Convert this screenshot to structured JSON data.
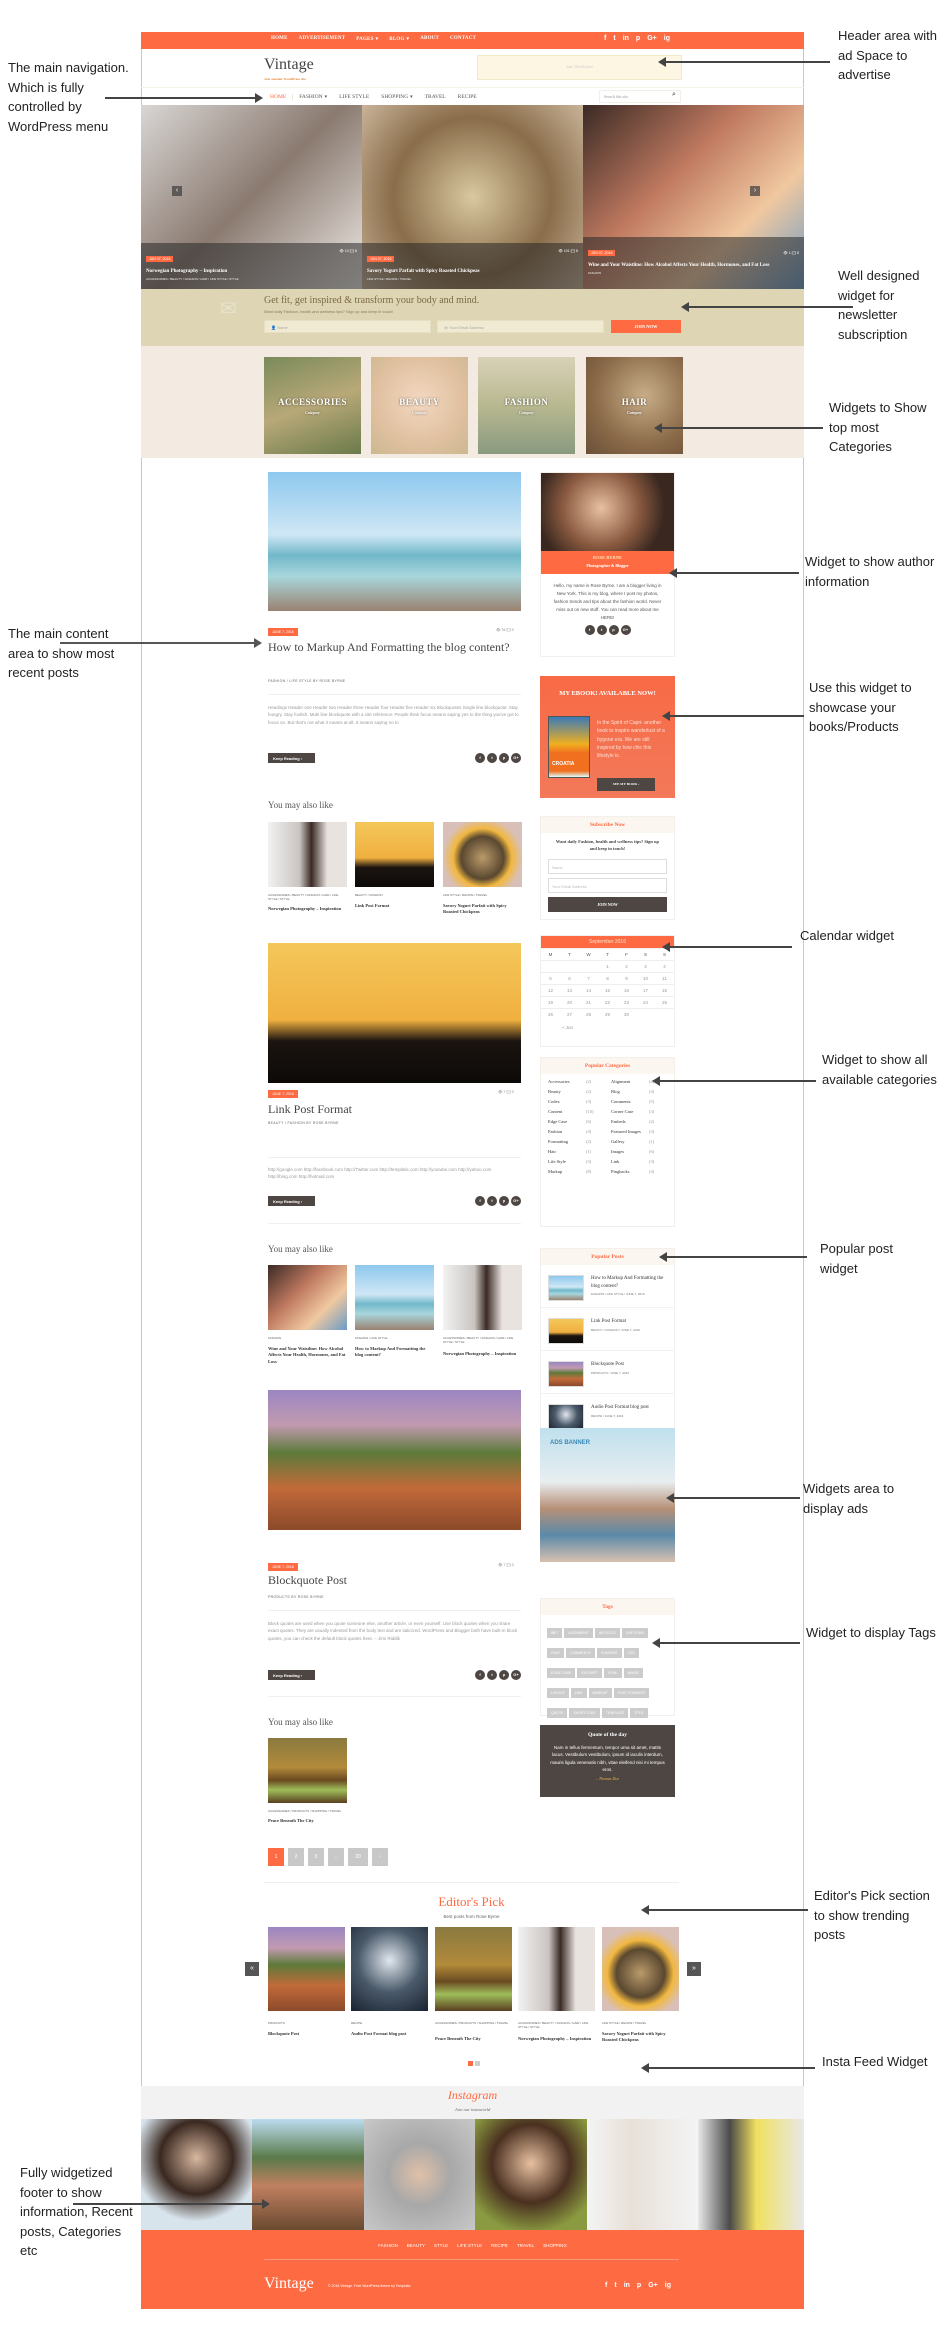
{
  "colors": {
    "accent": "#fe6a41",
    "dark": "#4d4643",
    "newsletter_bg": "#ded5b4",
    "category_band": "#f3ebe2"
  },
  "topbar": {
    "menu": [
      "HOME",
      "ADVERTISEMENT",
      "PAGES",
      "BLOG",
      "ABOUT",
      "CONTACT"
    ],
    "social": [
      "f",
      "t",
      "in",
      "p",
      "G+",
      "ig"
    ]
  },
  "header": {
    "logo": "Vintage",
    "tagline": "Just another WordPress site",
    "ad": "Ads 728x90 pixel"
  },
  "nav": {
    "items": [
      "HOME",
      "FASHION",
      "LIFE STYLE",
      "SHOPPING",
      "TRAVEL",
      "RECIPE"
    ],
    "search_placeholder": "Search this site"
  },
  "hero": [
    {
      "date": "JUN 07, 2016",
      "title": "Norwegian Photography – Inspiration",
      "cats": "ACCESSORIES / BEAUTY / FASHION / HAIR / LIFE STYLE / STYLE",
      "views": "10",
      "comments": "8"
    },
    {
      "date": "JUN 07, 2016",
      "title": "Savory Yogurt Parfait with Spicy Roasted Chickpeas",
      "cats": "LIFE STYLE / RECIPE / TRAVEL",
      "views": "101",
      "comments": "8"
    },
    {
      "date": "JUN 07, 2016",
      "title": "Wine and Your Waistline: How Alcohol Affects Your Health, Hormones, and Fat Loss",
      "cats": "FASHION",
      "views": "1",
      "comments": "8"
    }
  ],
  "newsletter": {
    "title": "Get fit, get inspired & transform your body and mind.",
    "subtitle": "Want daily Fashion, health and wellness tips? Sign up and keep in touch!",
    "name_placeholder": "Name",
    "email_placeholder": "Your Email Address",
    "button": "JOIN NOW"
  },
  "categories": [
    {
      "name": "ACCESSORIES",
      "sub": "Category"
    },
    {
      "name": "BEAUTY",
      "sub": "Category"
    },
    {
      "name": "FASHION",
      "sub": "Category"
    },
    {
      "name": "HAIR",
      "sub": "Category"
    }
  ],
  "posts": [
    {
      "date": "JUNE 7, 2016",
      "title": "How to Markup And Formatting the blog content?",
      "meta": "FASHION  /  LIFE STYLE BY ROSE BYRNE",
      "views": "76",
      "comments": "0",
      "excerpt": "Headings Header one Header two Header three Header four Header five Header six Blockquotes Single line blockquote: Stay hungry. Stay foolish. Multi line blockquote with a cite reference: People think focus means saying yes to the thing you've got to focus on. But that's not what it means at all. It means saying no to",
      "keep": "Keep Reading ›",
      "related": [
        {
          "cats": "ACCESSORIES / BEAUTY / FASHION / HAIR / LIFE STYLE / STYLE",
          "title": "Norwegian Photography – Inspiration"
        },
        {
          "cats": "BEAUTY / FASHION",
          "title": "Link Post Format"
        },
        {
          "cats": "LIFE STYLE / RECIPE / TRAVEL",
          "title": "Savory Yogurt Parfait with Spicy Roasted Chickpeas"
        }
      ]
    },
    {
      "date": "JUNE 7, 2016",
      "title": "Link Post Format",
      "meta": "BEAUTY  /  FASHION BY ROSE BYRNE",
      "views": "7",
      "comments": "0",
      "excerpt": "http://google.com http://facebook.com http://Twitter.com http://templatic.com http://youtube.com http://yahoo.com http://bing.com http://hotmail.com",
      "keep": "Keep Reading ›",
      "related": [
        {
          "cats": "FASHION",
          "title": "Wine and Your Waistline: How Alcohol Affects Your Health, Hormones, and Fat Loss"
        },
        {
          "cats": "FASHION / LIFE STYLE",
          "title": "How to Markup And Formatting the blog content?"
        },
        {
          "cats": "ACCESSORIES / BEAUTY / FASHION / HAIR / LIFE STYLE / STYLE",
          "title": "Norwegian Photography – Inspiration"
        }
      ]
    },
    {
      "date": "JUNE 7, 2016",
      "title": "Blockquote Post",
      "meta": "PRODUCTS BY ROSE BYRNE",
      "views": "7",
      "comments": "0",
      "excerpt": "Block quotes are used when you quote someone else, another article, or even yourself. Use block quotes when you share exact quotes. They are usually indented from the body text and are italicized. WordPress and Blogger both have built-in block quotes, you can check the default block quotes here. – Jimi Riddik",
      "keep": "Keep Reading ›",
      "related": [
        {
          "cats": "ACCESSORIES / PRODUCTS / SHOPPING / TRAVEL",
          "title": "Peace Beneath The City"
        }
      ]
    }
  ],
  "you_may_also_like": "You may also like",
  "pagination": [
    "1",
    "2",
    "3",
    "...",
    "20",
    "›"
  ],
  "sidebar": {
    "author": {
      "name": "ROSE BYRNE",
      "role": "Photographer & Blogger",
      "bio": "Hello, my name is Rose Byrne. I am a blogger living in New York. This is my blog, where I post my photos, fashion trends and tips about the fashion world. Never miss out on new stuff. You can read more about me HERE!"
    },
    "ebook": {
      "title": "MY EBOOK! AVAILABLE NOW!",
      "text": "In the Spirit of Capri- another book to inspire wanderlust of a bygone era. We are still inspired by how chic this lifestyle is.",
      "button": "SEE MY BOOK ›",
      "cover_text": "CROATIA"
    },
    "subscribe": {
      "title": "Subscribe Now",
      "text": "Want daily Fashion, health and wellness tips? Sign up and keep in touch!",
      "name_placeholder": "Name",
      "email_placeholder": "Your Email Address",
      "button": "JOIN NOW"
    },
    "calendar": {
      "month": "September 2016",
      "days": [
        "M",
        "T",
        "W",
        "T",
        "F",
        "S",
        "S"
      ],
      "rows": [
        [
          "",
          "",
          "",
          "1",
          "2",
          "3",
          "4"
        ],
        [
          "5",
          "6",
          "7",
          "8",
          "9",
          "10",
          "11"
        ],
        [
          "12",
          "13",
          "14",
          "15",
          "16",
          "17",
          "18"
        ],
        [
          "19",
          "20",
          "21",
          "22",
          "23",
          "24",
          "25"
        ],
        [
          "26",
          "27",
          "28",
          "29",
          "30",
          "",
          ""
        ]
      ],
      "prev": "« Jun"
    },
    "popular_categories": {
      "title": "Popular Categories",
      "items": [
        [
          "Accessories",
          "(2)"
        ],
        [
          "Alignment",
          "(4)"
        ],
        [
          "Beauty",
          "(2)"
        ],
        [
          "Blog",
          "(4)"
        ],
        [
          "Codex",
          "(3)"
        ],
        [
          "Comments",
          "(5)"
        ],
        [
          "Content",
          "(10)"
        ],
        [
          "Corner Case",
          "(3)"
        ],
        [
          "Edge Case",
          "(6)"
        ],
        [
          "Embeds",
          "(2)"
        ],
        [
          "Fashion",
          "(4)"
        ],
        [
          "Featured Images",
          "(3)"
        ],
        [
          "Formatting",
          "(2)"
        ],
        [
          "Gallery",
          "(1)"
        ],
        [
          "Hair",
          "(1)"
        ],
        [
          "Images",
          "(6)"
        ],
        [
          "Life Style",
          "(3)"
        ],
        [
          "Link",
          "(3)"
        ],
        [
          "Markup",
          "(8)"
        ],
        [
          "Pingbacks",
          "(4)"
        ]
      ]
    },
    "popular_posts": {
      "title": "Popular Posts",
      "items": [
        {
          "title": "How to Markup And Formatting the blog content?",
          "meta": "FASHION / LIFE STYLE / JUNE 7, 2016"
        },
        {
          "title": "Link Post Format",
          "meta": "BEAUTY / FASHION / JUNE 7, 2016"
        },
        {
          "title": "Blockquote Post",
          "meta": "PRODUCTS / JUNE 7, 2016"
        },
        {
          "title": "Audio Post Format blog post",
          "meta": "RECIPE / JUNE 7, 2016"
        }
      ]
    },
    "ad_banner": {
      "label": "ADS BANNER"
    },
    "tags": {
      "title": "Tags",
      "items": [
        "8BIT",
        "ALIGNMENT",
        "ARTICLES",
        "CAPTIONS",
        "CHAT",
        "COMMENTS",
        "CONTENT",
        "CSS",
        "EDGE CASE",
        "EXCERPT",
        "HTML",
        "IMAGE",
        "LAYOUT",
        "LINK",
        "MARKUP",
        "POST FORMATS",
        "QUOTE",
        "SHORTCODE",
        "TEMPLATE",
        "TITLE"
      ]
    },
    "quote": {
      "title": "Quote of the day",
      "text": "Nam in tellus fermentum, tempor urna sit amet, mattis lacus. Vestibulum vestibulum, ipsum id iaculis interdum, mauris ligula venenatis nibh, vitae eleifend nisi mi tempus eros.",
      "author": "– Thomas Doe"
    }
  },
  "editors_pick": {
    "title": "Editor's Pick",
    "subtitle": "Best posts from Rose Byrne",
    "items": [
      {
        "cats": "PRODUCTS",
        "title": "Blockquote Post"
      },
      {
        "cats": "RECIPE",
        "title": "Audio Post Format blog post"
      },
      {
        "cats": "ACCESSORIES / PRODUCTS / SHOPPING / TRAVEL",
        "title": "Peace Beneath The City"
      },
      {
        "cats": "ACCESSORIES / BEAUTY / FASHION / HAIR / LIFE STYLE / STYLE",
        "title": "Norwegian Photography – Inspiration"
      },
      {
        "cats": "LIFE STYLE / RECIPE / TRAVEL",
        "title": "Savory Yogurt Parfait with Spicy Roasted Chickpeas"
      }
    ],
    "active_page": 1,
    "pages": 2
  },
  "instagram": {
    "title": "Instagram",
    "subtitle": "Join our instaworld"
  },
  "footer": {
    "menu": [
      "FASHION",
      "BEAUTY",
      "STYLE",
      "LIFE STYLE",
      "RECIPE",
      "TRAVEL",
      "SHOPPING"
    ],
    "logo": "Vintage",
    "copyright": "© 2016 Vintage. Free WordPress theme by Templatic",
    "social": [
      "f",
      "t",
      "in",
      "p",
      "G+",
      "ig"
    ]
  },
  "annotations": {
    "nav": "The main navigation. Which is fully controlled by WordPress menu",
    "content": "The main content area to show most recent posts",
    "footer": "Fully widgetized footer to show information, Recent posts, Categories etc",
    "header": "Header area with ad Space to advertise",
    "newsletter": "Well designed widget for newsletter subscription",
    "categories": "Widgets to Show top most Categories",
    "author": "Widget to show author information",
    "books": "Use this widget to showcase your books/Products",
    "calendar": "Calendar widget",
    "all_categories": "Widget to show all available categories",
    "popular": "Popular post widget",
    "ads": "Widgets area to display ads",
    "tags": "Widget to display Tags",
    "editors": "Editor's Pick section to show trending posts",
    "insta": "Insta Feed Widget"
  }
}
